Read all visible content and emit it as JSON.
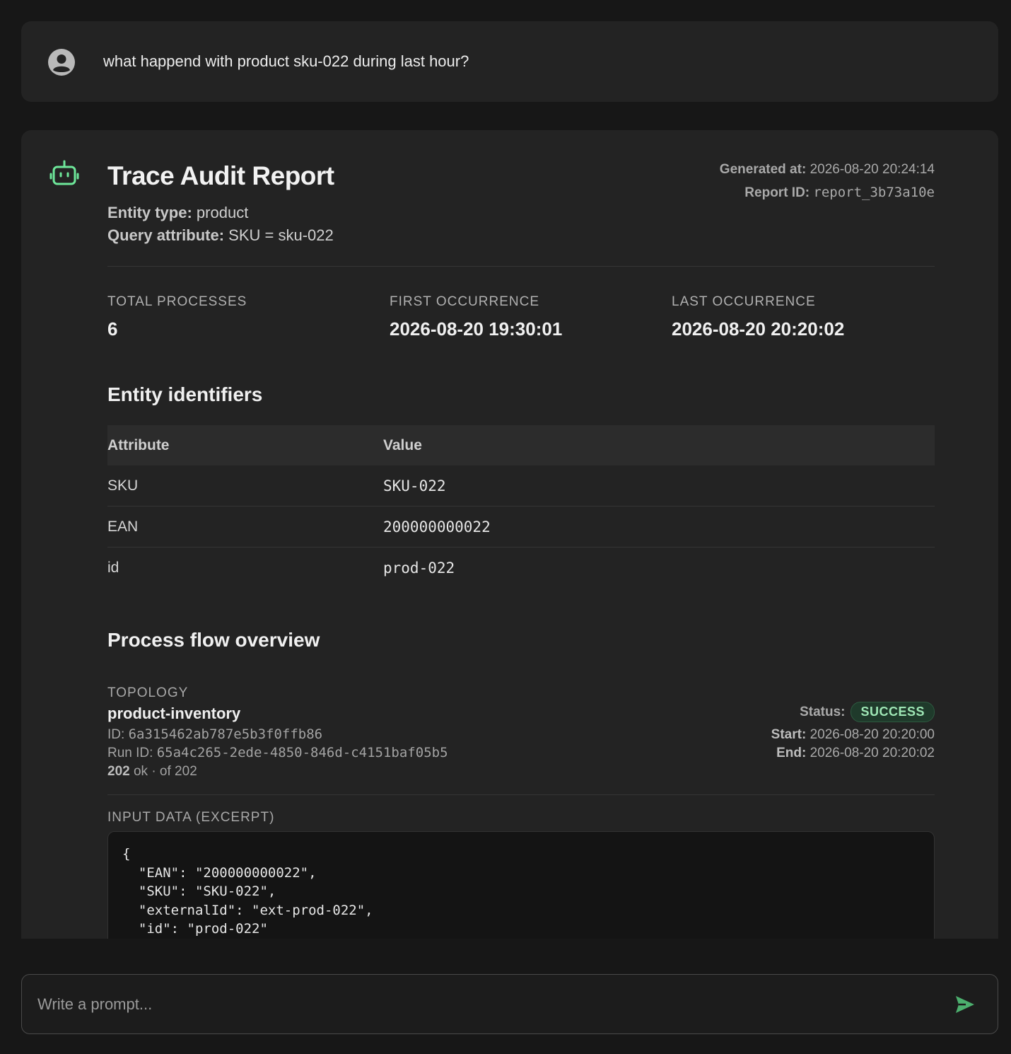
{
  "user_message": {
    "text": "what happend with product sku-022 during last hour?",
    "avatar_icon": "user-avatar-icon"
  },
  "report": {
    "icon": "robot-icon",
    "accent_color": "#6ee79a",
    "title": "Trace Audit Report",
    "entity_type_label": "Entity type:",
    "entity_type_value": "product",
    "query_attribute_label": "Query attribute:",
    "query_attribute_value": "SKU = sku-022",
    "generated_at_label": "Generated at:",
    "generated_at_value": "2026-08-20 20:24:14",
    "report_id_label": "Report ID:",
    "report_id_value": "report_3b73a10e",
    "stats": [
      {
        "label": "TOTAL PROCESSES",
        "value": "6"
      },
      {
        "label": "FIRST OCCURRENCE",
        "value": "2026-08-20 19:30:01"
      },
      {
        "label": "LAST OCCURRENCE",
        "value": "2026-08-20 20:20:02"
      }
    ],
    "identifiers": {
      "heading": "Entity identifiers",
      "columns": [
        "Attribute",
        "Value"
      ],
      "rows": [
        {
          "attribute": "SKU",
          "value": "SKU-022"
        },
        {
          "attribute": "EAN",
          "value": "200000000022"
        },
        {
          "attribute": "id",
          "value": "prod-022"
        }
      ]
    },
    "process_flow": {
      "heading": "Process flow overview",
      "topology_label": "TOPOLOGY",
      "topology_name": "product-inventory",
      "id_label": "ID:",
      "id_value": "6a315462ab787e5b3f0ffb86",
      "run_id_label": "Run ID:",
      "run_id_value": "65a4c265-2ede-4850-846d-c4151baf05b5",
      "ok_count": "202",
      "ok_text": "ok · of 202",
      "status_label": "Status:",
      "status_value": "SUCCESS",
      "status_color": "#9ee6b5",
      "start_label": "Start:",
      "start_value": "2026-08-20 20:20:00",
      "end_label": "End:",
      "end_value": "2026-08-20 20:20:02",
      "input_label": "INPUT DATA (EXCERPT)",
      "input_code": "{\n  \"EAN\": \"200000000022\",\n  \"SKU\": \"SKU-022\",\n  \"externalId\": \"ext-prod-022\",\n  \"id\": \"prod-022\"\n}"
    }
  },
  "composer": {
    "placeholder": "Write a prompt...",
    "send_icon": "send-icon"
  }
}
